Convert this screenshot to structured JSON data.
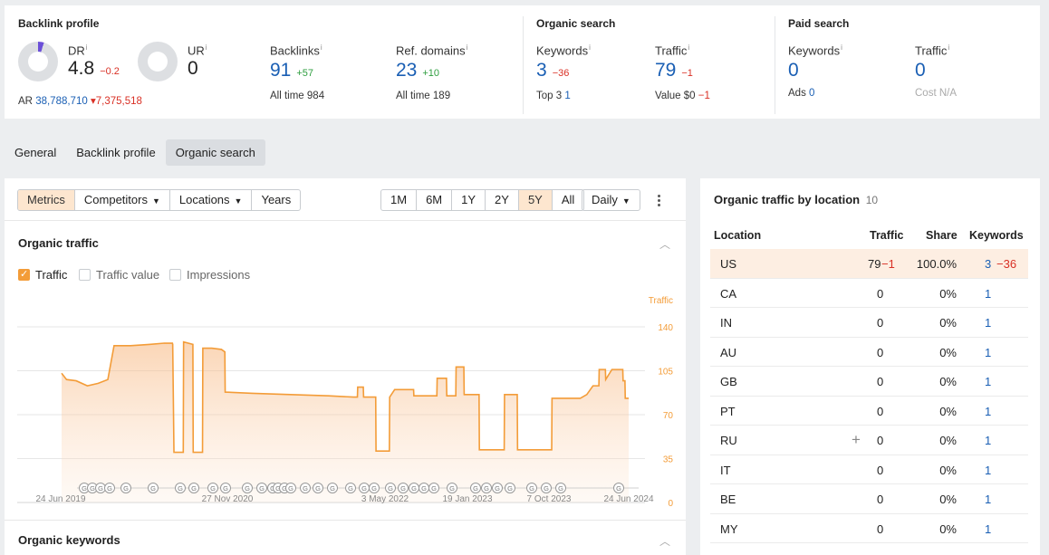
{
  "backlink_profile": {
    "title": "Backlink profile",
    "dr": {
      "label": "DR",
      "info": "i",
      "value": "4.8",
      "delta": "−0.2",
      "donut_fraction": 0.048
    },
    "ur": {
      "label": "UR",
      "info": "i",
      "value": "0",
      "donut_fraction": 0
    },
    "ar": {
      "label": "AR",
      "value": "38,788,710",
      "delta": "▾7,375,518"
    },
    "backlinks": {
      "label": "Backlinks",
      "info": "i",
      "value": "91",
      "delta": "+57",
      "sub_label": "All time",
      "sub_value": "984"
    },
    "ref_domains": {
      "label": "Ref. domains",
      "info": "i",
      "value": "23",
      "delta": "+10",
      "sub_label": "All time",
      "sub_value": "189"
    }
  },
  "organic_search": {
    "title": "Organic search",
    "keywords": {
      "label": "Keywords",
      "info": "i",
      "value": "3",
      "delta": "−36",
      "sub_label": "Top 3",
      "sub_value": "1"
    },
    "traffic": {
      "label": "Traffic",
      "info": "i",
      "value": "79",
      "delta": "−1",
      "sub_label": "Value",
      "sub_value": "$0",
      "sub_delta": "−1"
    }
  },
  "paid_search": {
    "title": "Paid search",
    "keywords": {
      "label": "Keywords",
      "info": "i",
      "value": "0",
      "sub_label": "Ads",
      "sub_value": "0"
    },
    "traffic": {
      "label": "Traffic",
      "info": "i",
      "value": "0",
      "sub_label": "Cost",
      "sub_value": "N/A"
    }
  },
  "tabs": [
    "General",
    "Backlink profile",
    "Organic search"
  ],
  "toolbar": {
    "views": [
      "Metrics",
      "Competitors",
      "Locations",
      "Years"
    ],
    "periods": [
      "1M",
      "6M",
      "1Y",
      "2Y",
      "5Y",
      "All"
    ],
    "interval": "Daily",
    "more_icon": "vertical-dots-icon"
  },
  "organic_traffic_panel": {
    "title": "Organic traffic",
    "checkboxes": [
      {
        "label": "Traffic",
        "checked": true
      },
      {
        "label": "Traffic value",
        "checked": false
      },
      {
        "label": "Impressions",
        "checked": false
      }
    ]
  },
  "organic_keywords_panel": {
    "title": "Organic keywords"
  },
  "chart_data": {
    "type": "area",
    "title": "",
    "ylabel": "Traffic",
    "ylim": [
      0,
      140
    ],
    "yticks": [
      0,
      35,
      70,
      105,
      140
    ],
    "x_tick_labels": [
      "24 Jun 2019",
      "27 Nov 2020",
      "3 May 2022",
      "19 Jan 2023",
      "7 Oct 2023",
      "24 Jun 2024"
    ],
    "x_range": [
      "2019-06-24",
      "2024-06-24"
    ],
    "series": [
      {
        "color": "#f39c38",
        "points": [
          [
            "2019-06-24",
            103
          ],
          [
            "2019-07-10",
            98
          ],
          [
            "2019-08-10",
            97
          ],
          [
            "2019-09-15",
            93
          ],
          [
            "2019-10-20",
            95
          ],
          [
            "2019-11-20",
            98
          ],
          [
            "2019-12-10",
            125
          ],
          [
            "2020-02-01",
            125
          ],
          [
            "2020-04-01",
            126
          ],
          [
            "2020-05-20",
            127
          ],
          [
            "2020-06-15",
            127
          ],
          [
            "2020-06-16",
            126
          ],
          [
            "2020-06-20",
            40
          ],
          [
            "2020-07-20",
            40
          ],
          [
            "2020-07-21",
            128
          ],
          [
            "2020-08-20",
            126
          ],
          [
            "2020-08-21",
            40
          ],
          [
            "2020-09-20",
            40
          ],
          [
            "2020-09-21",
            123
          ],
          [
            "2020-10-20",
            123
          ],
          [
            "2020-11-20",
            122
          ],
          [
            "2020-12-01",
            120
          ],
          [
            "2020-12-02",
            88
          ],
          [
            "2021-03-01",
            87
          ],
          [
            "2021-07-01",
            86
          ],
          [
            "2021-11-01",
            85
          ],
          [
            "2022-01-20",
            84
          ],
          [
            "2022-02-01",
            84
          ],
          [
            "2022-02-02",
            92
          ],
          [
            "2022-02-20",
            92
          ],
          [
            "2022-02-21",
            84
          ],
          [
            "2022-04-01",
            84
          ],
          [
            "2022-04-02",
            41
          ],
          [
            "2022-05-15",
            41
          ],
          [
            "2022-05-16",
            84
          ],
          [
            "2022-06-01",
            90
          ],
          [
            "2022-08-01",
            90
          ],
          [
            "2022-08-02",
            85
          ],
          [
            "2022-10-15",
            85
          ],
          [
            "2022-10-16",
            99
          ],
          [
            "2022-11-15",
            99
          ],
          [
            "2022-11-16",
            85
          ],
          [
            "2022-12-15",
            85
          ],
          [
            "2022-12-16",
            108
          ],
          [
            "2023-01-10",
            108
          ],
          [
            "2023-01-11",
            86
          ],
          [
            "2023-02-28",
            86
          ],
          [
            "2023-03-01",
            42
          ],
          [
            "2023-05-20",
            42
          ],
          [
            "2023-05-21",
            86
          ],
          [
            "2023-07-01",
            86
          ],
          [
            "2023-07-02",
            42
          ],
          [
            "2023-10-20",
            42
          ],
          [
            "2023-10-21",
            83
          ],
          [
            "2024-01-20",
            83
          ],
          [
            "2024-02-10",
            86
          ],
          [
            "2024-03-01",
            93
          ],
          [
            "2024-03-20",
            93
          ],
          [
            "2024-03-21",
            106
          ],
          [
            "2024-04-10",
            106
          ],
          [
            "2024-04-11",
            98
          ],
          [
            "2024-05-01",
            106
          ],
          [
            "2024-06-05",
            106
          ],
          [
            "2024-06-06",
            97
          ],
          [
            "2024-06-12",
            97
          ],
          [
            "2024-06-13",
            83
          ],
          [
            "2024-06-24",
            83
          ]
        ]
      }
    ],
    "annotation_marker": "G",
    "annotation_marker_count": 36
  },
  "organic_traffic_by_location": {
    "title": "Organic traffic by location",
    "count": "10",
    "columns": [
      "Location",
      "Traffic",
      "Share",
      "Keywords"
    ],
    "rows": [
      {
        "location": "US",
        "traffic": "79",
        "traffic_delta": "−1",
        "share": "100.0%",
        "keywords": "3",
        "keywords_delta": "−36"
      },
      {
        "location": "CA",
        "traffic": "0",
        "share": "0%",
        "keywords": "1"
      },
      {
        "location": "IN",
        "traffic": "0",
        "share": "0%",
        "keywords": "1"
      },
      {
        "location": "AU",
        "traffic": "0",
        "share": "0%",
        "keywords": "1"
      },
      {
        "location": "GB",
        "traffic": "0",
        "share": "0%",
        "keywords": "1"
      },
      {
        "location": "PT",
        "traffic": "0",
        "share": "0%",
        "keywords": "1"
      },
      {
        "location": "RU",
        "traffic": "0",
        "share": "0%",
        "keywords": "1",
        "add_icon": "plus-icon",
        "add_glyph": "+"
      },
      {
        "location": "IT",
        "traffic": "0",
        "share": "0%",
        "keywords": "1"
      },
      {
        "location": "BE",
        "traffic": "0",
        "share": "0%",
        "keywords": "1"
      },
      {
        "location": "MY",
        "traffic": "0",
        "share": "0%",
        "keywords": "1"
      }
    ]
  }
}
